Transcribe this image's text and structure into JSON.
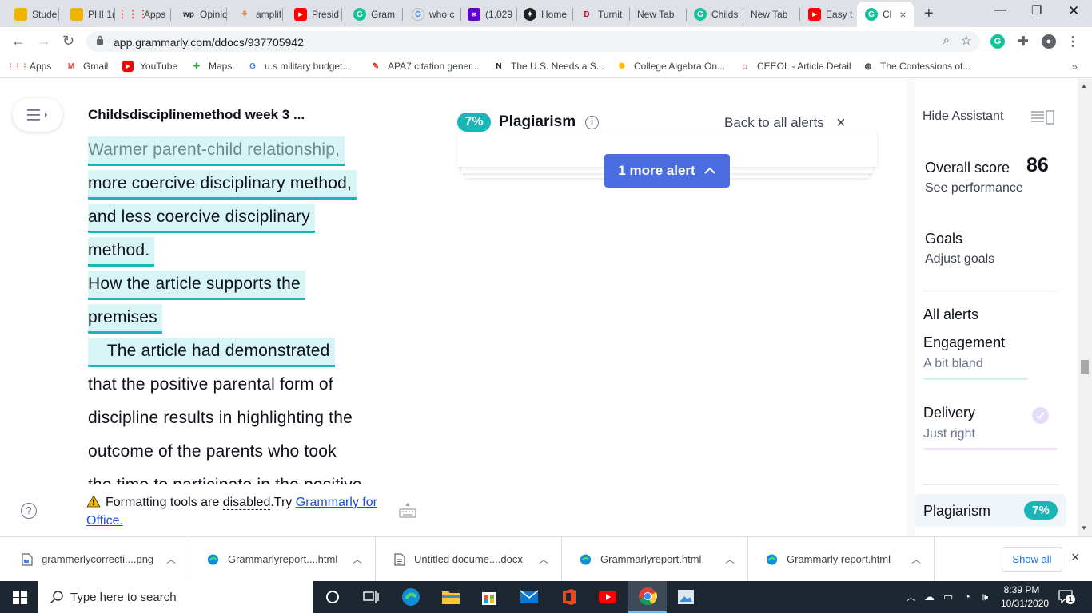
{
  "browser": {
    "tabs": [
      {
        "label": "Stude",
        "color": "#f0b400"
      },
      {
        "label": "PHI 1(",
        "color": "#f0b400"
      },
      {
        "label": "Apps",
        "color": "#ea4335"
      },
      {
        "label": "Opinio",
        "color": "#202124"
      },
      {
        "label": "amplif",
        "color": "#e8710a"
      },
      {
        "label": "Presid",
        "color": "#ff0000"
      },
      {
        "label": "Gram",
        "color": "#15c39a"
      },
      {
        "label": "who c",
        "color": "#4285f4"
      },
      {
        "label": "(1,029",
        "color": "#6001d2"
      },
      {
        "label": "Home",
        "color": "#202124"
      },
      {
        "label": "Turnit",
        "color": "#c8102e"
      },
      {
        "label": "New Tab",
        "color": ""
      },
      {
        "label": "Childs",
        "color": "#15c39a"
      },
      {
        "label": "New Tab",
        "color": ""
      },
      {
        "label": "Easy t",
        "color": "#ff0000"
      },
      {
        "label": "Cl",
        "color": "#15c39a"
      }
    ],
    "active_tab_close": "×",
    "new_tab": "+",
    "url": "app.grammarly.com/ddocs/937705942",
    "bookmarks": [
      {
        "label": "Apps"
      },
      {
        "label": "Gmail"
      },
      {
        "label": "YouTube"
      },
      {
        "label": "Maps"
      },
      {
        "label": "u.s military budget..."
      },
      {
        "label": "APA7 citation gener..."
      },
      {
        "label": "The U.S. Needs a S..."
      },
      {
        "label": "College Algebra On..."
      },
      {
        "label": "CEEOL - Article Detail"
      },
      {
        "label": "The Confessions of..."
      }
    ],
    "bookmarks_more": "»"
  },
  "editor": {
    "doc_title": "Childsdisciplinemethod week 3 ...",
    "lines": [
      "Warmer parent-child relationship,",
      "more coercive disciplinary method,",
      "and less coercive disciplinary",
      "method.",
      "How the article supports the",
      "premises",
      "    The article had demonstrated",
      "that the positive parental form of",
      "discipline results in highlighting the",
      "outcome of the parents who took",
      "the time to participate in the positive"
    ],
    "format_note": {
      "text1": "Formatting tools are",
      "dashed": "disabled",
      "text2": ".Try",
      "link": "Grammarly for Office."
    },
    "help": "?"
  },
  "plagiarism_card": {
    "badge": "7%",
    "title": "Plagiarism",
    "info": "i",
    "back_link": "Back to all alerts",
    "close": "×",
    "more_alert": "1 more alert"
  },
  "assistant": {
    "hide_label": "Hide Assistant",
    "overall_score_label": "Overall score",
    "overall_score": "86",
    "see_performance": "See performance",
    "goals": "Goals",
    "adjust_goals": "Adjust goals",
    "all_alerts": "All alerts",
    "engagement": "Engagement",
    "engagement_sub": "A bit bland",
    "delivery": "Delivery",
    "delivery_sub": "Just right",
    "plagiarism": "Plagiarism",
    "plagiarism_badge": "7%",
    "colors": {
      "engagement": "#d1f3ec",
      "delivery": "#f0dff4",
      "accent": "#1ab5b7"
    }
  },
  "downloads": {
    "items": [
      {
        "name": "grammerlycorrecti....png",
        "icon": "image-file-icon"
      },
      {
        "name": "Grammarlyreport....html",
        "icon": "edge-icon"
      },
      {
        "name": "Untitled docume....docx",
        "icon": "document-file-icon"
      },
      {
        "name": "Grammarlyreport.html",
        "icon": "edge-icon"
      },
      {
        "name": "Grammarly report.html",
        "icon": "edge-icon"
      }
    ],
    "show_all": "Show all",
    "close": "×"
  },
  "taskbar": {
    "search_placeholder": "Type here to search",
    "time": "8:39 PM",
    "date": "10/31/2020",
    "notifications": "1"
  }
}
